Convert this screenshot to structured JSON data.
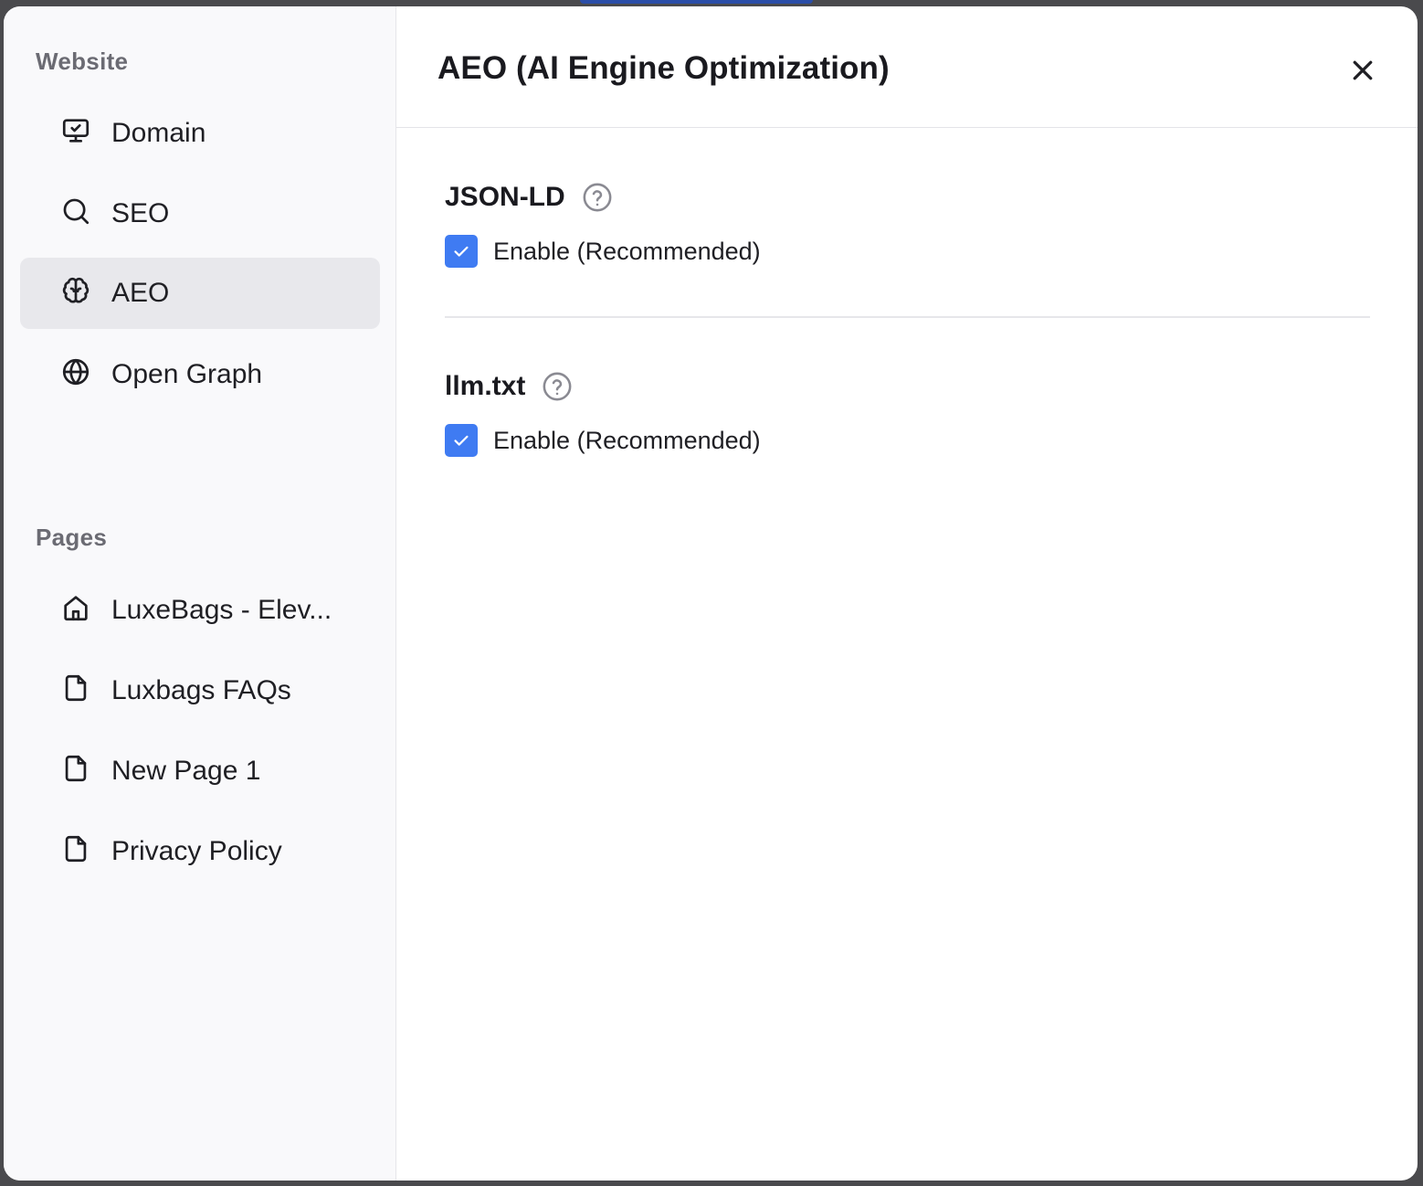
{
  "sidebar": {
    "website_section": {
      "title": "Website",
      "items": [
        {
          "label": "Domain",
          "icon": "monitor-check-icon",
          "active": false
        },
        {
          "label": "SEO",
          "icon": "search-icon",
          "active": false
        },
        {
          "label": "AEO",
          "icon": "brain-icon",
          "active": true
        },
        {
          "label": "Open Graph",
          "icon": "globe-icon",
          "active": false
        }
      ]
    },
    "pages_section": {
      "title": "Pages",
      "items": [
        {
          "label": "LuxeBags - Elev...",
          "icon": "home-icon"
        },
        {
          "label": "Luxbags FAQs",
          "icon": "file-icon"
        },
        {
          "label": "New Page 1",
          "icon": "file-icon"
        },
        {
          "label": "Privacy Policy",
          "icon": "file-icon"
        }
      ]
    }
  },
  "header": {
    "title": "AEO (AI Engine Optimization)",
    "close_icon": "close-icon"
  },
  "settings": {
    "json_ld": {
      "title": "JSON-LD",
      "help_icon": "help-circle-icon",
      "checkbox_label": "Enable (Recommended)",
      "checked": true
    },
    "llm_txt": {
      "title": "llm.txt",
      "help_icon": "help-circle-icon",
      "checkbox_label": "Enable (Recommended)",
      "checked": true
    }
  },
  "colors": {
    "accent": "#3f7bf2",
    "sidebar_bg": "#f9f9fb",
    "active_item_bg": "#e8e8ec"
  }
}
